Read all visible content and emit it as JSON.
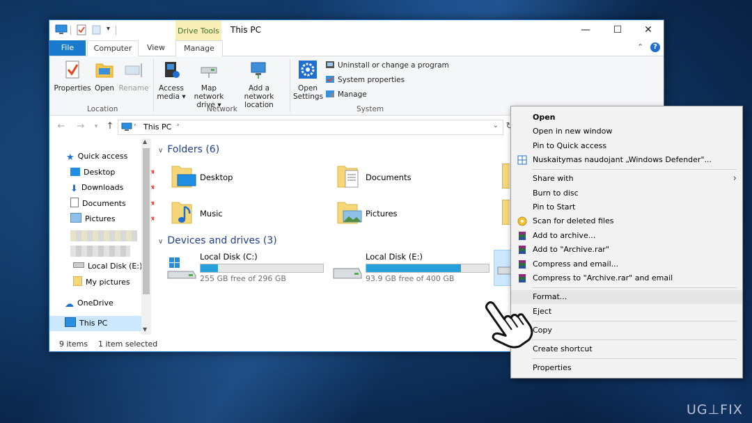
{
  "window": {
    "title": "This PC",
    "drive_tools_label": "Drive Tools",
    "accent": "#1979ca"
  },
  "tabs": [
    {
      "label": "File"
    },
    {
      "label": "Computer"
    },
    {
      "label": "View"
    },
    {
      "label": "Manage"
    }
  ],
  "ribbon": {
    "location": {
      "group_label": "Location",
      "properties": "Properties",
      "open": "Open",
      "rename": "Rename"
    },
    "network": {
      "group_label": "Network",
      "access_media_1": "Access",
      "access_media_2": "media ▾",
      "map_drive_1": "Map network",
      "map_drive_2": "drive ▾",
      "add_location_1": "Add a network",
      "add_location_2": "location"
    },
    "system": {
      "group_label": "System",
      "open_settings_1": "Open",
      "open_settings_2": "Settings",
      "uninstall": "Uninstall or change a program",
      "system_properties": "System properties",
      "manage": "Manage"
    }
  },
  "address": {
    "path": "This PC"
  },
  "nav": {
    "quick_access": "Quick access",
    "desktop": "Desktop",
    "downloads": "Downloads",
    "documents": "Documents",
    "pictures": "Pictures",
    "local_disk_e": "Local Disk (E:)",
    "my_pictures": "My pictures",
    "onedrive": "OneDrive",
    "this_pc": "This PC"
  },
  "content": {
    "folders_header": "Folders (6)",
    "folders": [
      {
        "name": "Desktop"
      },
      {
        "name": "Documents"
      },
      {
        "name": "Music"
      },
      {
        "name": "Pictures"
      }
    ],
    "drives_header": "Devices and drives (3)",
    "drives": [
      {
        "name": "Local Disk (C:)",
        "free": "255 GB free of 296 GB",
        "used_fraction": 0.14
      },
      {
        "name": "Local Disk (E:)",
        "free": "93.9 GB free of 400 GB",
        "used_fraction": 0.77
      }
    ]
  },
  "status": {
    "items": "9 items",
    "selected": "1 item selected"
  },
  "context_menu": {
    "open": "Open",
    "open_new_window": "Open in new window",
    "pin_quick": "Pin to Quick access",
    "defender": "Nuskaitymas naudojant „Windows Defender\"...",
    "share_with": "Share with",
    "burn": "Burn to disc",
    "pin_start": "Pin to Start",
    "scan_deleted": "Scan for deleted files",
    "add_archive": "Add to archive...",
    "add_archive_rar": "Add to \"Archive.rar\"",
    "compress_email": "Compress and email...",
    "compress_rar_email": "Compress to \"Archive.rar\" and email",
    "format": "Format...",
    "eject": "Eject",
    "copy": "Copy",
    "create_shortcut": "Create shortcut",
    "properties": "Properties"
  },
  "watermark": "UG⊥FIX"
}
